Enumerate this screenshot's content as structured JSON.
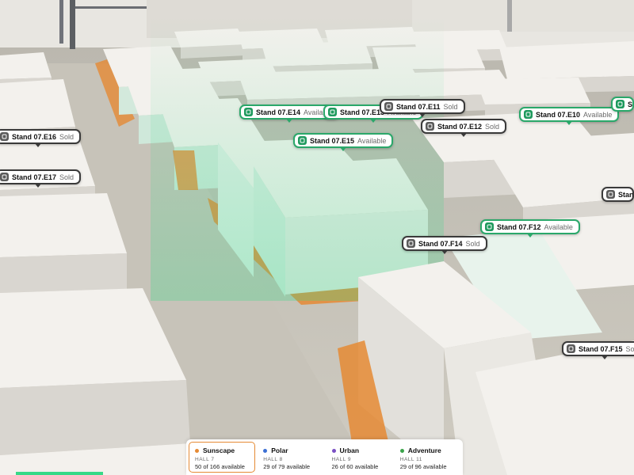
{
  "stands": [
    {
      "id": "07.E16",
      "label": "Stand 07.E16",
      "status": "Sold"
    },
    {
      "id": "07.E17",
      "label": "Stand 07.E17",
      "status": "Sold"
    },
    {
      "id": "07.E14",
      "label": "Stand 07.E14",
      "status": "Available"
    },
    {
      "id": "07.E13",
      "label": "Stand 07.E13",
      "status": "Available"
    },
    {
      "id": "07.E11",
      "label": "Stand 07.E11",
      "status": "Sold"
    },
    {
      "id": "07.E12",
      "label": "Stand 07.E12",
      "status": "Sold"
    },
    {
      "id": "07.E10",
      "label": "Stand 07.E10",
      "status": "Available"
    },
    {
      "id": "07.E15",
      "label": "Stand 07.E15",
      "status": "Available"
    },
    {
      "id": "07.F12",
      "label": "Stand 07.F12",
      "status": "Available"
    },
    {
      "id": "07.F14",
      "label": "Stand 07.F14",
      "status": "Sold"
    },
    {
      "id": "07.F15",
      "label": "Stand 07.F15",
      "status": "Sold"
    },
    {
      "id": "edge-right-1",
      "label": "Stand",
      "status": ""
    },
    {
      "id": "edge-right-2",
      "label": "Stand",
      "status": ""
    }
  ],
  "halls": [
    {
      "name": "Sunscape",
      "hall": "HALL 7",
      "availability": "50 of 166 available",
      "color": "#e58a34",
      "active": true
    },
    {
      "name": "Polar",
      "hall": "HALL 8",
      "availability": "29 of 79 available",
      "color": "#3b6fd4",
      "active": false
    },
    {
      "name": "Urban",
      "hall": "HALL 9",
      "availability": "26 of 60 available",
      "color": "#7a4fc4",
      "active": false
    },
    {
      "name": "Adventure",
      "hall": "HALL 11",
      "availability": "29 of 96 available",
      "color": "#3aa34a",
      "active": false
    }
  ],
  "colors": {
    "available": "#2aa86a",
    "sold": "#3a3a3a",
    "floor": "#c9c5bb",
    "box": "#f1efeb",
    "glow": "#3ddc8a",
    "hall_accent": "#e58a34"
  }
}
